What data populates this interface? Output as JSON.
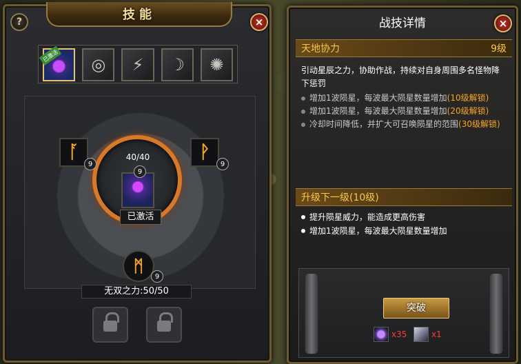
{
  "left_panel": {
    "title": "技能",
    "help_label": "?",
    "close_label": "×",
    "skills": [
      {
        "name": "active-skill",
        "glyph": "✦",
        "badge": "已激活"
      },
      {
        "name": "skill-2",
        "glyph": "◎"
      },
      {
        "name": "skill-3",
        "glyph": "⚡"
      },
      {
        "name": "skill-4",
        "glyph": "☽"
      },
      {
        "name": "skill-5",
        "glyph": "✺"
      }
    ],
    "main_skill": {
      "progress": "40/40",
      "level": "9",
      "status": "已激活"
    },
    "sub_skills": {
      "left": {
        "glyph": "ᚪ",
        "level": "9"
      },
      "right": {
        "glyph": "ᚹ",
        "level": "9"
      },
      "bottom": {
        "glyph": "ᛗ",
        "level": "9"
      }
    },
    "power_text": "无双之力:50/50"
  },
  "right_panel": {
    "title": "战技详情",
    "close_label": "×",
    "skill_name": "天地协力",
    "skill_level": "9级",
    "description": "引动星辰之力，协助作战，持续对自身周围多名怪物降下惩罚",
    "unlocks": [
      {
        "text": "增加1波陨星，每波最大陨星数量增加",
        "tag": "(10级解锁)"
      },
      {
        "text": "增加1波陨星，每波最大陨星数量增加",
        "tag": "(20级解锁)"
      },
      {
        "text": "冷却时间降低，并扩大可召唤陨星的范围",
        "tag": "(30级解锁)"
      }
    ],
    "next_level_header": "升级下一级(10级)",
    "next_level_items": [
      "提升陨星威力，能造成更高伤害",
      "增加1波陨星，每波最大陨星数量增加"
    ],
    "breakthrough_label": "突破",
    "costs": [
      {
        "qty": "x35"
      },
      {
        "qty": "x1"
      }
    ]
  },
  "colors": {
    "accent_gold": "#f6c84a",
    "ring_orange": "#d8792a",
    "unlock_orange": "#f5a623",
    "cost_red": "#ff3a3a"
  }
}
